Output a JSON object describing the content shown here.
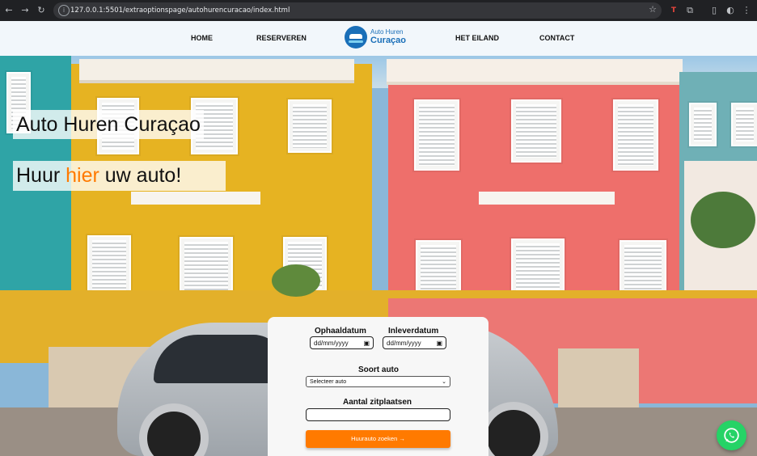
{
  "browser": {
    "url": "127.0.0.1:5501/extraoptionspage/autohurencuracao/index.html",
    "icons": [
      "back-icon",
      "forward-icon",
      "reload-icon",
      "site-info-icon",
      "bookmark-star-icon",
      "extension-icon",
      "puzzle-icon",
      "sidepanel-icon",
      "profile-icon",
      "menu-icon"
    ]
  },
  "header": {
    "menu": [
      "HOME",
      "RESERVEREN",
      "HET EILAND",
      "CONTACT"
    ],
    "logo_line1": "Auto Huren",
    "logo_line2": "Curaçao"
  },
  "hero": {
    "title": "Auto Huren Curaçao",
    "subtitle_before": "Huur ",
    "subtitle_accent": "hier",
    "subtitle_after": " uw auto!",
    "accent_color": "#ff7a00"
  },
  "form": {
    "pickup_label": "Ophaaldatum",
    "pickup_placeholder": "dd/mm/yyyy",
    "return_label": "Inleverdatum",
    "return_placeholder": "dd/mm/yyyy",
    "car_type_label": "Soort auto",
    "car_type_selected": "Selecteer auto",
    "seats_label": "Aantal zitplaatsen",
    "seats_value": "",
    "submit_label": "Huurauto zoeken →",
    "button_color": "#ff7a00"
  },
  "whatsapp": {
    "icon": "whatsapp-icon",
    "color": "#25d366"
  }
}
